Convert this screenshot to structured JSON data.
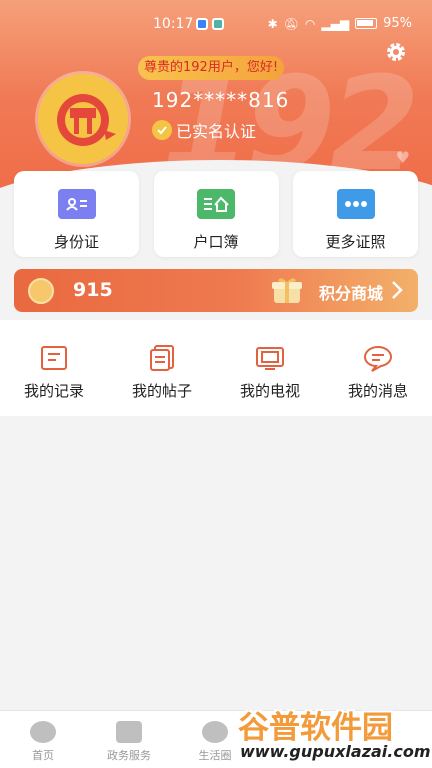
{
  "status_bar": {
    "time": "10:17",
    "battery": "95%"
  },
  "header": {
    "background_text": "192",
    "greeting": "尊贵的192用户，您好!",
    "phone": "192*****816",
    "verified_label": "已实名认证"
  },
  "cards": [
    {
      "label": "身份证",
      "icon": "id-card-icon"
    },
    {
      "label": "户口簿",
      "icon": "household-register-icon"
    },
    {
      "label": "更多证照",
      "icon": "more-icon"
    }
  ],
  "points": {
    "value": "915",
    "mall_label": "积分商城"
  },
  "menu": [
    {
      "label": "我的记录",
      "icon": "record-icon"
    },
    {
      "label": "我的帖子",
      "icon": "posts-icon"
    },
    {
      "label": "我的电视",
      "icon": "tv-icon"
    },
    {
      "label": "我的消息",
      "icon": "message-icon"
    }
  ],
  "tabbar": [
    {
      "label": "首页",
      "icon": "home-icon"
    },
    {
      "label": "政务服务",
      "icon": "briefcase-icon"
    },
    {
      "label": "生活圈",
      "icon": "play-icon"
    }
  ],
  "watermark": {
    "title": "谷普软件园",
    "url": "www.gupuxlazai.com"
  },
  "colors": {
    "accent": "#ef6a45",
    "gold": "#f6c445"
  }
}
